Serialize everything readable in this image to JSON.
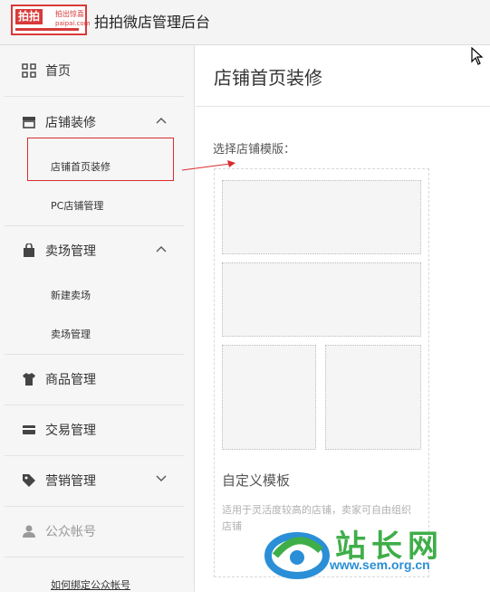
{
  "header": {
    "logo": {
      "brand": "拍拍",
      "tagline": "拍出惊喜",
      "domain": "paipai.com"
    },
    "title": "拍拍微店管理后台"
  },
  "sidebar": {
    "items": [
      {
        "label": "首页",
        "icon": "grid-icon"
      },
      {
        "label": "店铺装修",
        "icon": "store-icon",
        "expanded": true,
        "children": [
          {
            "label": "店铺首页装修",
            "highlighted": true
          },
          {
            "label": "PC店铺管理"
          }
        ]
      },
      {
        "label": "卖场管理",
        "icon": "shopping-bag-icon",
        "expanded": true,
        "children": [
          {
            "label": "新建卖场"
          },
          {
            "label": "卖场管理"
          }
        ]
      },
      {
        "label": "商品管理",
        "icon": "tshirt-icon"
      },
      {
        "label": "交易管理",
        "icon": "card-icon"
      },
      {
        "label": "营销管理",
        "icon": "tag-icon",
        "expanded": false
      },
      {
        "label": "公众帐号",
        "icon": "user-icon",
        "disabled": true,
        "children": [
          {
            "label": "如何绑定公众帐号",
            "link": true
          }
        ]
      }
    ]
  },
  "main": {
    "title": "店铺首页装修",
    "select_label": "选择店铺模版：",
    "template": {
      "name": "自定义模板",
      "description": "适用于灵活度较高的店铺，卖家可自由组织店铺"
    }
  },
  "watermark": {
    "text": "站长网",
    "url": "www.sem.org.cn"
  },
  "colors": {
    "accent_red": "#d83a3a",
    "highlight_red": "#d92d2d",
    "watermark_green": "#3fae49",
    "watermark_blue": "#2a8fd6"
  }
}
